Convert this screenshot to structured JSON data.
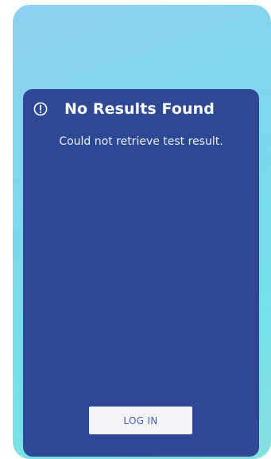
{
  "card": {
    "icon": "alert-circle-icon",
    "title": "No Results Found",
    "message": "Could not retrieve test result."
  },
  "actions": {
    "login_label": "LOG IN"
  },
  "colors": {
    "background_gradient_start": "#8dd0f3",
    "background_gradient_end": "#75e0e7",
    "card_background": "#2e4895",
    "button_background": "#f2f4f8",
    "button_text": "#4b63a6"
  }
}
